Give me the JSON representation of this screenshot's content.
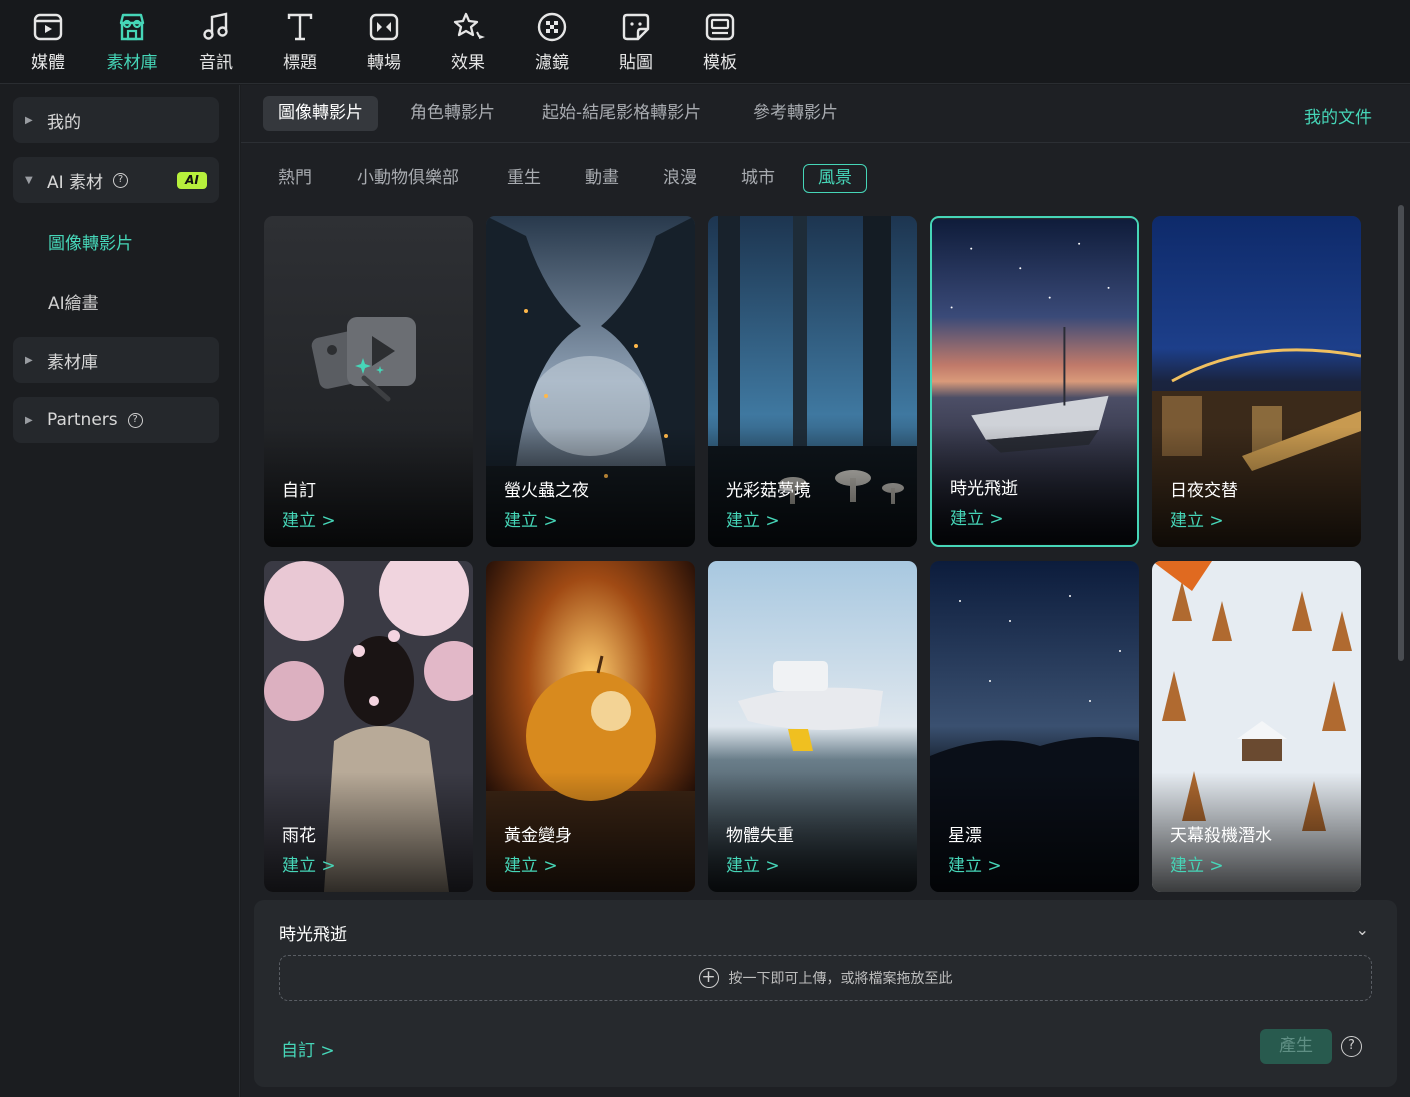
{
  "toolbar": {
    "items": [
      {
        "label": "媒體",
        "icon": "media-icon"
      },
      {
        "label": "素材庫",
        "icon": "store-icon"
      },
      {
        "label": "音訊",
        "icon": "music-note-icon"
      },
      {
        "label": "標題",
        "icon": "text-t-icon"
      },
      {
        "label": "轉場",
        "icon": "transition-icon"
      },
      {
        "label": "效果",
        "icon": "effects-icon"
      },
      {
        "label": "濾鏡",
        "icon": "filter-icon"
      },
      {
        "label": "貼圖",
        "icon": "sticker-icon"
      },
      {
        "label": "模板",
        "icon": "template-icon"
      }
    ],
    "active_index": 1
  },
  "sidebar": {
    "mine": "我的",
    "ai_assets": "AI 素材",
    "ai_badge": "AI",
    "image_to_video": "圖像轉影片",
    "ai_painting": "AI繪畫",
    "library": "素材庫",
    "partners": "Partners"
  },
  "subtabs": {
    "items": [
      "圖像轉影片",
      "角色轉影片",
      "起始-結尾影格轉影片",
      "參考轉影片"
    ],
    "my_docs": "我的文件"
  },
  "chips": {
    "items": [
      "熱門",
      "小動物俱樂部",
      "重生",
      "動畫",
      "浪漫",
      "城市",
      "風景"
    ],
    "active": "風景"
  },
  "cards": {
    "create_label": "建立 >",
    "items": [
      {
        "title": "自訂"
      },
      {
        "title": "螢火蟲之夜"
      },
      {
        "title": "光彩菇夢境"
      },
      {
        "title": "時光飛逝"
      },
      {
        "title": "日夜交替"
      },
      {
        "title": "雨花"
      },
      {
        "title": "黃金變身"
      },
      {
        "title": "物體失重"
      },
      {
        "title": "星漂"
      },
      {
        "title": "天幕殺機潛水"
      }
    ],
    "selected_index": 3
  },
  "panel": {
    "title": "時光飛逝",
    "dropzone_text": "按一下即可上傳，或將檔案拖放至此",
    "custom_link": "自訂 >",
    "generate_button": "產生",
    "help": "?"
  },
  "colors": {
    "accent": "#46d6b8",
    "background": "#1b1d20",
    "ai_badge": "#b7f03c"
  }
}
